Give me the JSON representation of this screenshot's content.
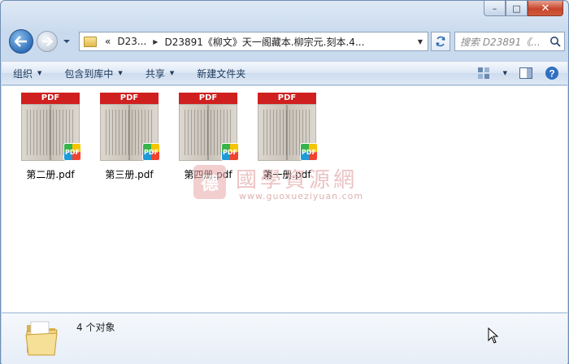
{
  "window": {
    "caption_buttons": {
      "minimize": "–",
      "maximize": "□",
      "close": "✕"
    }
  },
  "nav": {
    "address_prefix": "«",
    "breadcrumb": [
      "D23...",
      "D23891《柳文》天一阁藏本.柳宗元.刻本.4..."
    ],
    "search_placeholder": "搜索 D23891《..."
  },
  "toolbar": {
    "organize": "组织",
    "include_in_library": "包含到库中",
    "share": "共享",
    "new_folder": "新建文件夹"
  },
  "files": [
    {
      "name": "第二册.pdf",
      "label": "PDF",
      "badge": "PDF"
    },
    {
      "name": "第三册.pdf",
      "label": "PDF",
      "badge": "PDF"
    },
    {
      "name": "第四册.pdf",
      "label": "PDF",
      "badge": "PDF"
    },
    {
      "name": "第一册.pdf",
      "label": "PDF",
      "badge": "PDF"
    }
  ],
  "watermark": {
    "logo_char": "德",
    "cn": "國學資源網",
    "en": "www.guoxueziyuan.com"
  },
  "status": {
    "count": "4 个对象"
  },
  "colors": {
    "pdf_red": "#d01f1f",
    "frame_blue": "#c3d5eb"
  }
}
